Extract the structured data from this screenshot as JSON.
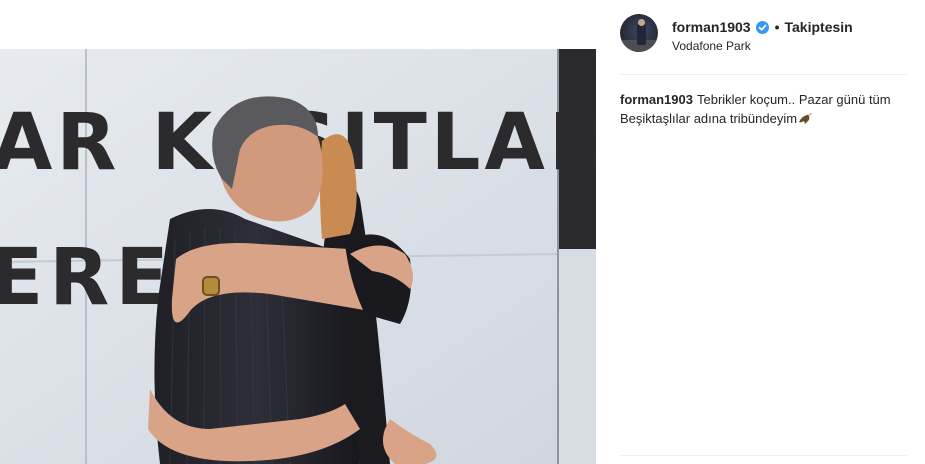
{
  "post": {
    "username": "forman1903",
    "verified": true,
    "separator": "•",
    "follow_status": "Takiptesin",
    "location": "Vodafone Park"
  },
  "caption": {
    "username": "forman1903",
    "text": "Tebrikler koçum.. Pazar günü tüm Beşiktaşlılar adına tribündeyim",
    "emoji": "eagle-icon"
  },
  "photo": {
    "wall_text_line1": "AR KAŞITLARA",
    "wall_text_line2": "ERE  ER."
  },
  "colors": {
    "text": "#262626",
    "verified_badge": "#3897f0",
    "divider": "#efefef"
  }
}
